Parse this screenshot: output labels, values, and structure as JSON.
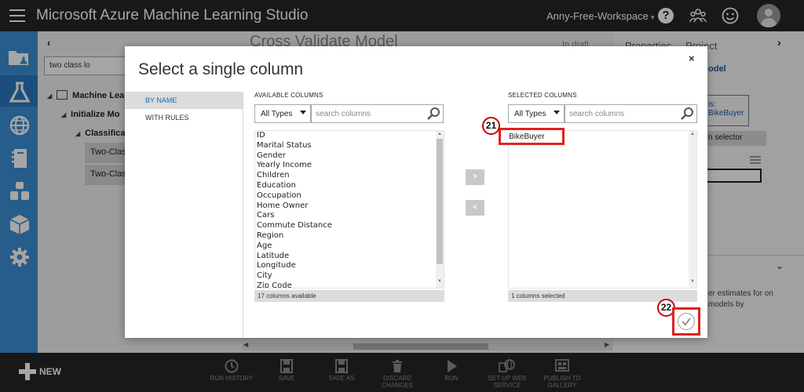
{
  "app": {
    "title": "Microsoft Azure Machine Learning Studio",
    "workspace": "Anny-Free-Workspace",
    "workspace_caret": "▾"
  },
  "header": {
    "help_label": "?"
  },
  "background": {
    "collapse_glyph": "‹",
    "search_value": "two class lo",
    "tree": {
      "root": "Machine Lea",
      "child": "Initialize Mo",
      "grandchild": "Classificat",
      "leaf1": "Two-Clas",
      "leaf2": "Two-Clas"
    },
    "canvas_title": "Cross Validate Model",
    "canvas_status": "In draft",
    "props": {
      "tab_properties": "Properties",
      "tab_project": "Project",
      "chevron": "›",
      "model_fragment": "odel",
      "box_label_fragment": "is:",
      "box_value_fragment": "BikeBuyer",
      "selector_fragment": "n selector",
      "desc_fragment": "er estimates for on models by",
      "collapse_chevron": "⌄"
    }
  },
  "dialog": {
    "title": "Select a single column",
    "close": "×",
    "tabs": [
      {
        "label": "BY NAME"
      },
      {
        "label": "WITH RULES"
      }
    ],
    "available": {
      "header": "AVAILABLE COLUMNS",
      "type_filter": "All Types",
      "search_placeholder": "search columns",
      "items": [
        "ID",
        "Marital Status",
        "Gender",
        "Yearly Income",
        "Children",
        "Education",
        "Occupation",
        "Home Owner",
        "Cars",
        "Commute Distance",
        "Region",
        "Age",
        "Latitude",
        "Longitude",
        "City",
        "Zip Code"
      ],
      "count_text": "17 columns available"
    },
    "selected": {
      "header": "SELECTED COLUMNS",
      "type_filter": "All Types",
      "search_placeholder": "search columns",
      "items": [
        "BikeBuyer"
      ],
      "count_text": "1 columns selected"
    },
    "move_right": ">",
    "move_left": "<",
    "step_badges": {
      "first": "21",
      "second": "22"
    }
  },
  "bottombar": {
    "new_label": "NEW",
    "tools": [
      {
        "label": "RUN HISTORY",
        "icon": "clock-icon"
      },
      {
        "label": "SAVE",
        "icon": "floppy-icon"
      },
      {
        "label": "SAVE AS",
        "icon": "floppy-icon"
      },
      {
        "label": "DISCARD CHANGES",
        "icon": "trash-icon"
      },
      {
        "label": "RUN",
        "icon": "play-icon"
      },
      {
        "label": "SET UP WEB SERVICE",
        "icon": "web-service-icon"
      },
      {
        "label": "PUBLISH TO GALLERY",
        "icon": "gallery-icon"
      }
    ]
  },
  "colors": {
    "topbar": "#262626",
    "sidenav": "#3b8fd6",
    "highlight_red": "#e02020",
    "accent_blue": "#1a6eb5"
  }
}
